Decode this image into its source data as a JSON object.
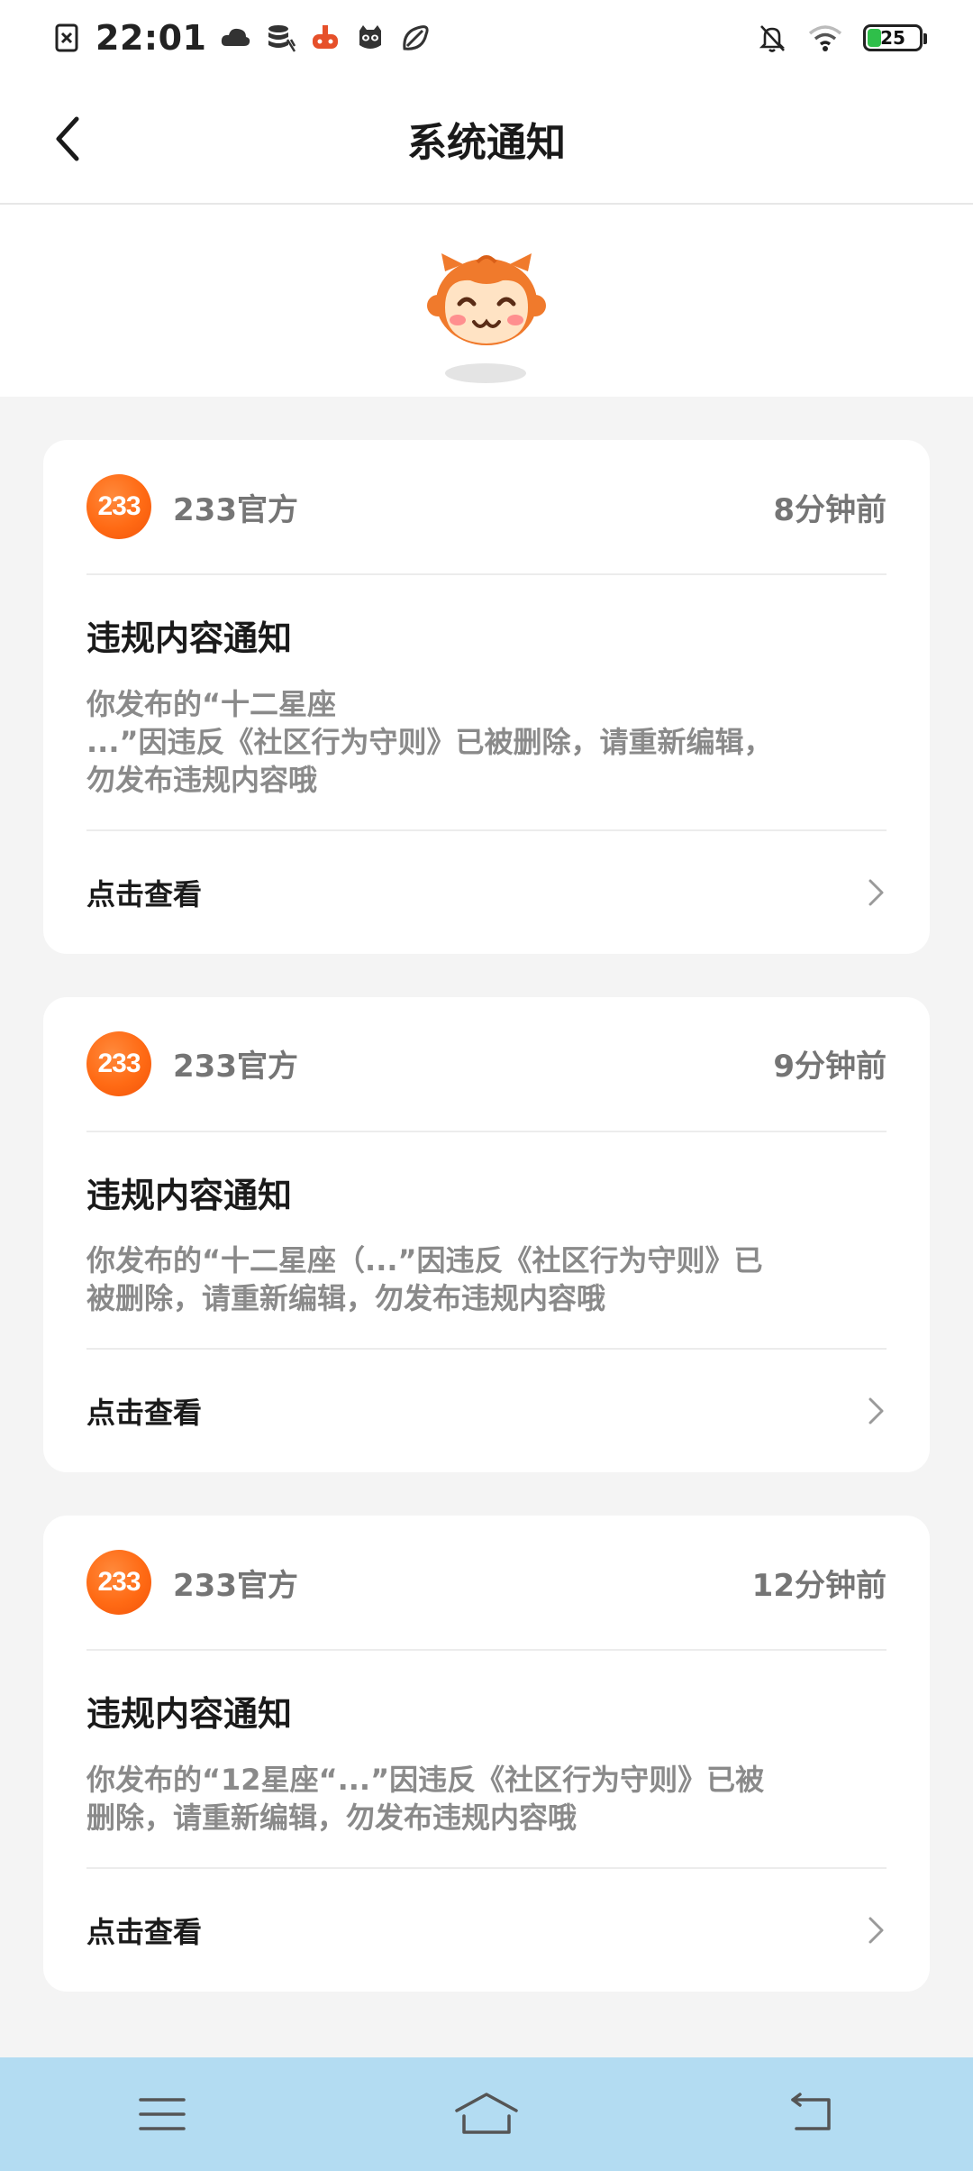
{
  "status_bar": {
    "time": "22:01",
    "battery_level": "25",
    "battery_fraction": 0.25,
    "left_icons": [
      "sim-off-icon",
      "cloud-icon",
      "data-stack-icon",
      "game-controller-icon",
      "cat-face-icon",
      "leaf-icon"
    ],
    "right_icons": [
      "mute-bell-icon",
      "wifi-icon",
      "battery-icon"
    ]
  },
  "header": {
    "title": "系统通知",
    "back_icon": "chevron-left-icon"
  },
  "mascot": {
    "icon": "monkey-mascot-icon"
  },
  "notifications": [
    {
      "avatar_text": "233",
      "sender": "233官方",
      "time": "8分钟前",
      "title": "违规内容通知",
      "content": "你发布的“十二星座\n...”因违反《社区行为守则》已被删除，请重新编辑，\n勿发布违规内容哦",
      "action": "点击查看"
    },
    {
      "avatar_text": "233",
      "sender": "233官方",
      "time": "9分钟前",
      "title": "违规内容通知",
      "content": "你发布的“十二星座（...”因违反《社区行为守则》已\n被删除，请重新编辑，勿发布违规内容哦",
      "action": "点击查看"
    },
    {
      "avatar_text": "233",
      "sender": "233官方",
      "time": "12分钟前",
      "title": "违规内容通知",
      "content": "你发布的“12星座“...”因违反《社区行为守则》已被\n删除，请重新编辑，勿发布违规内容哦",
      "action": "点击查看"
    }
  ],
  "nav_bar": {
    "icons": [
      "menu-icon",
      "home-icon",
      "back-icon"
    ],
    "color": "#b3dcf2"
  },
  "colors": {
    "accent": "#ff6a14",
    "background": "#f4f4f4",
    "card": "#ffffff"
  }
}
